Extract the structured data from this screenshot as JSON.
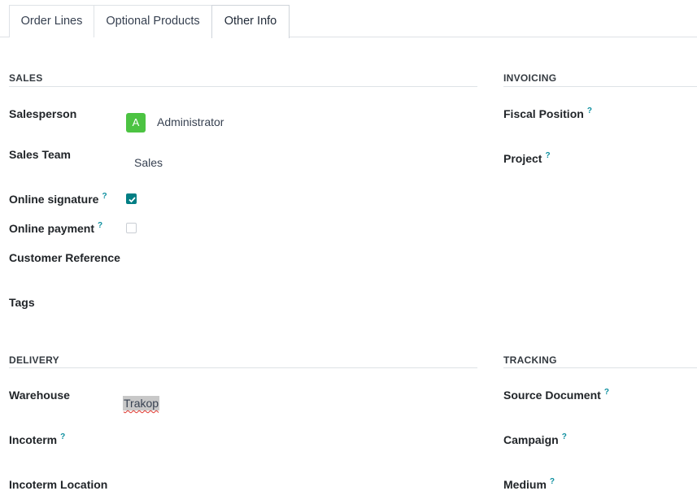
{
  "tabs": [
    {
      "label": "Order Lines",
      "active": false
    },
    {
      "label": "Optional Products",
      "active": false
    },
    {
      "label": "Other Info",
      "active": true
    }
  ],
  "sales": {
    "title": "SALES",
    "salesperson_label": "Salesperson",
    "salesperson_avatar": "A",
    "salesperson_value": "Administrator",
    "sales_team_label": "Sales Team",
    "sales_team_value": "Sales",
    "online_signature_label": "Online signature",
    "online_signature_checked": true,
    "online_payment_label": "Online payment",
    "online_payment_checked": false,
    "customer_reference_label": "Customer Reference",
    "tags_label": "Tags"
  },
  "invoicing": {
    "title": "INVOICING",
    "fiscal_position_label": "Fiscal Position",
    "project_label": "Project"
  },
  "delivery": {
    "title": "DELIVERY",
    "warehouse_label": "Warehouse",
    "warehouse_value": "Trakop",
    "incoterm_label": "Incoterm",
    "incoterm_location_label": "Incoterm Location"
  },
  "tracking": {
    "title": "TRACKING",
    "source_document_label": "Source Document",
    "campaign_label": "Campaign",
    "medium_label": "Medium"
  },
  "help_marker": "?",
  "colors": {
    "accent": "#017e84",
    "help": "#0d8f9f",
    "avatar": "#4cc342",
    "spellcheck": "#e0342b"
  }
}
